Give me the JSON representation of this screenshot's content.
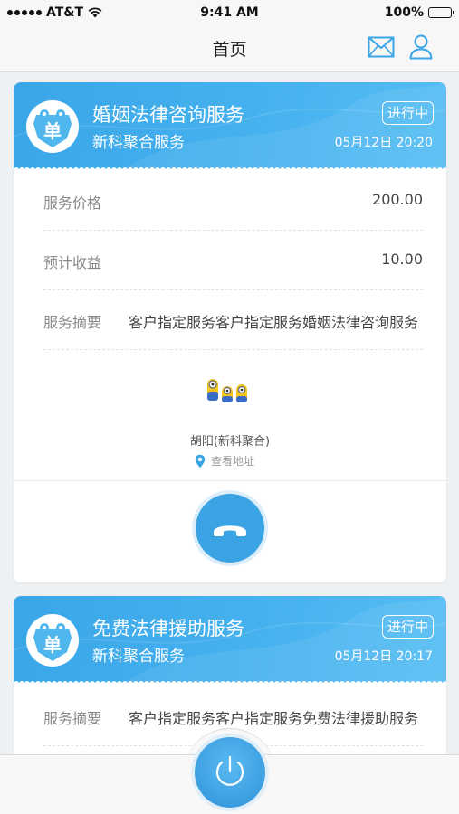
{
  "status_bar": {
    "carrier": "AT&T",
    "time": "9:41 AM",
    "battery": "100%"
  },
  "nav": {
    "title": "首页",
    "mail_icon": "mail-icon",
    "user_icon": "user-icon"
  },
  "colors": {
    "brand_blue": "#3aa6e8",
    "status_gray": "#8a8a8a"
  },
  "orders": [
    {
      "logo_text": "单",
      "title": "婚姻法律咨询服务",
      "company": "新科聚合服务",
      "status": "进行中",
      "time": "05月12日 20:20",
      "rows": [
        {
          "label": "服务价格",
          "value": "200.00"
        },
        {
          "label": "预计收益",
          "value": "10.00"
        },
        {
          "label": "服务摘要",
          "value": "客户指定服务客户指定服务婚姻法律咨询服务"
        }
      ],
      "customer": "胡阳(新科聚合)",
      "address_link": "查看地址"
    },
    {
      "logo_text": "单",
      "title": "免费法律援助服务",
      "company": "新科聚合服务",
      "status": "进行中",
      "time": "05月12日 20:17",
      "rows": [
        {
          "label": "服务摘要",
          "value": "客户指定服务客户指定服务免费法律援助服务"
        }
      ]
    }
  ]
}
